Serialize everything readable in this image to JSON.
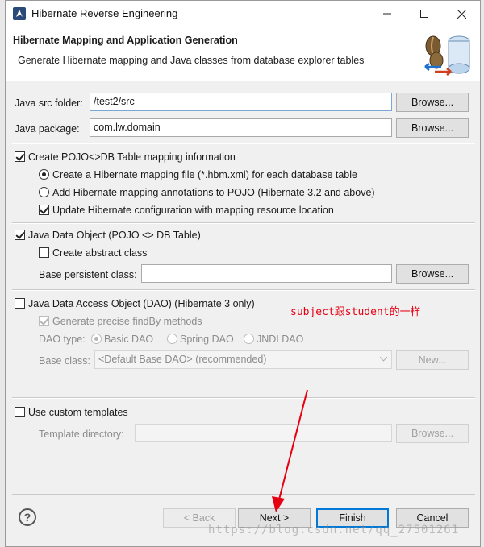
{
  "window": {
    "title": "Hibernate Reverse Engineering"
  },
  "banner": {
    "heading": "Hibernate Mapping and Application Generation",
    "description": "Generate Hibernate mapping and Java classes from database explorer tables"
  },
  "source": {
    "java_src_label": "Java src folder:",
    "java_src_value": "/test2/src",
    "java_package_label": "Java package:",
    "java_package_value": "com.lw.domain",
    "browse_label": "Browse..."
  },
  "mapping": {
    "create_pojo_label": "Create POJO<>DB Table mapping information",
    "create_pojo_checked": true,
    "opt_hbm_label": "Create a Hibernate mapping file (*.hbm.xml) for each database table",
    "opt_annotations_label": "Add Hibernate mapping annotations to POJO (Hibernate 3.2 and above)",
    "selected_option": "hbm",
    "update_config_label": "Update Hibernate configuration with mapping resource location",
    "update_config_checked": true
  },
  "data_object": {
    "label": "Java Data Object (POJO <> DB Table)",
    "checked": true,
    "abstract_label": "Create abstract class",
    "abstract_checked": false,
    "base_persistent_label": "Base persistent class:",
    "base_persistent_value": ""
  },
  "dao": {
    "label": "Java Data Access Object (DAO) (Hibernate 3 only)",
    "checked": false,
    "findby_label": "Generate precise findBy methods",
    "findby_checked": true,
    "type_label": "DAO type:",
    "type_basic": "Basic DAO",
    "type_spring": "Spring DAO",
    "type_jndi": "JNDI DAO",
    "selected_type": "basic",
    "base_class_label": "Base class:",
    "base_class_value": "<Default Base DAO> (recommended)",
    "new_label": "New..."
  },
  "templates": {
    "label": "Use custom templates",
    "checked": false,
    "dir_label": "Template directory:",
    "dir_value": ""
  },
  "footer": {
    "back_label": "< Back",
    "next_label": "Next >",
    "finish_label": "Finish",
    "cancel_label": "Cancel"
  },
  "annotation_note": "subject跟student的一样",
  "watermark": "https://blog.csdn.net/qq_27501261",
  "colors": {
    "annotation": "#e60012",
    "focus_border": "#0078d7"
  }
}
